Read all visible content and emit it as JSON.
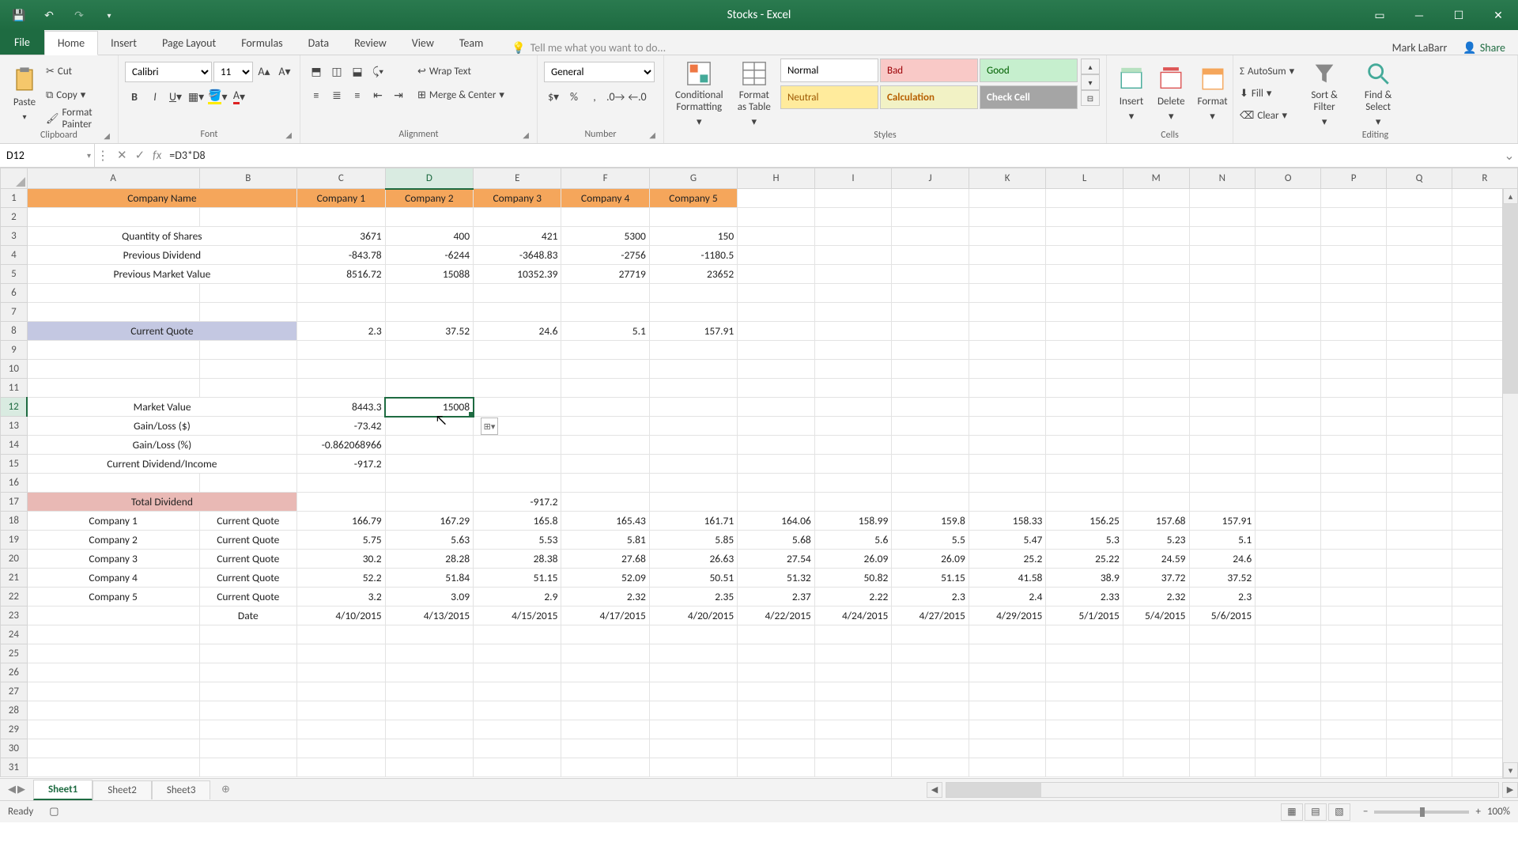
{
  "title": "Stocks - Excel",
  "account": "Mark LaBarr",
  "share": "Share",
  "tabs": {
    "file": "File",
    "home": "Home",
    "insert": "Insert",
    "pagelayout": "Page Layout",
    "formulas": "Formulas",
    "data": "Data",
    "review": "Review",
    "view": "View",
    "team": "Team"
  },
  "tellme": "Tell me what you want to do...",
  "clipboard": {
    "label": "Clipboard",
    "paste": "Paste",
    "cut": "Cut",
    "copy": "Copy",
    "painter": "Format Painter"
  },
  "font": {
    "label": "Font",
    "name": "Calibri",
    "size": "11"
  },
  "alignment": {
    "label": "Alignment",
    "wrap": "Wrap Text",
    "merge": "Merge & Center"
  },
  "number": {
    "label": "Number",
    "format": "General"
  },
  "stylesgrp": {
    "label": "Styles",
    "cond": "Conditional Formatting",
    "fmtTable": "Format as Table",
    "normal": "Normal",
    "bad": "Bad",
    "good": "Good",
    "neutral": "Neutral",
    "calc": "Calculation",
    "check": "Check Cell"
  },
  "cells": {
    "label": "Cells",
    "insert": "Insert",
    "delete": "Delete",
    "format": "Format"
  },
  "editing": {
    "label": "Editing",
    "autosum": "AutoSum",
    "fill": "Fill",
    "clear": "Clear",
    "sort": "Sort & Filter",
    "find": "Find & Select"
  },
  "namebox": "D12",
  "formula": "=D3*D8",
  "columns": [
    "A",
    "B",
    "C",
    "D",
    "E",
    "F",
    "G",
    "H",
    "I",
    "J",
    "K",
    "L",
    "M",
    "N",
    "O",
    "P",
    "Q",
    "R"
  ],
  "colpx": [
    220,
    124,
    112,
    112,
    112,
    112,
    112,
    98,
    98,
    98,
    98,
    98,
    84,
    84,
    84,
    84,
    84,
    84
  ],
  "selCol": 3,
  "selRow": 11,
  "rows": [
    [
      {
        "t": "Company Name",
        "s": "hdr-orange",
        "span": 2
      },
      null,
      {
        "t": "Company 1",
        "s": "hdr-orange"
      },
      {
        "t": "Company 2",
        "s": "hdr-orange"
      },
      {
        "t": "Company 3",
        "s": "hdr-orange"
      },
      {
        "t": "Company 4",
        "s": "hdr-orange"
      },
      {
        "t": "Company 5",
        "s": "hdr-orange"
      }
    ],
    [],
    [
      {
        "t": "Quantity of Shares",
        "s": "lbl",
        "span": 2
      },
      null,
      {
        "t": "3671"
      },
      {
        "t": "400"
      },
      {
        "t": "421"
      },
      {
        "t": "5300"
      },
      {
        "t": "150"
      }
    ],
    [
      {
        "t": "Previous Dividend",
        "s": "lbl",
        "span": 2
      },
      null,
      {
        "t": "-843.78"
      },
      {
        "t": "-6244"
      },
      {
        "t": "-3648.83"
      },
      {
        "t": "-2756"
      },
      {
        "t": "-1180.5"
      }
    ],
    [
      {
        "t": "Previous Market Value",
        "s": "lbl",
        "span": 2
      },
      null,
      {
        "t": "8516.72"
      },
      {
        "t": "15088"
      },
      {
        "t": "10352.39"
      },
      {
        "t": "27719"
      },
      {
        "t": "23652"
      }
    ],
    [],
    [],
    [
      {
        "t": "Current Quote",
        "s": "hdr-blue",
        "span": 2
      },
      null,
      {
        "t": "2.3"
      },
      {
        "t": "37.52"
      },
      {
        "t": "24.6"
      },
      {
        "t": "5.1"
      },
      {
        "t": "157.91"
      }
    ],
    [],
    [],
    [],
    [
      {
        "t": "Market Value",
        "s": "lbl",
        "span": 2
      },
      null,
      {
        "t": "8443.3"
      },
      {
        "t": "15008",
        "sel": true
      }
    ],
    [
      {
        "t": "Gain/Loss ($)",
        "s": "lbl",
        "span": 2
      },
      null,
      {
        "t": "-73.42"
      }
    ],
    [
      {
        "t": "Gain/Loss (%)",
        "s": "lbl",
        "span": 2
      },
      null,
      {
        "t": "-0.862068966"
      }
    ],
    [
      {
        "t": "Current Dividend/Income",
        "s": "lbl",
        "span": 2
      },
      null,
      {
        "t": "-917.2"
      }
    ],
    [],
    [
      {
        "t": "Total Dividend",
        "s": "hdr-pink",
        "span": 2
      },
      null,
      {
        "t": ""
      },
      {
        "t": ""
      },
      {
        "t": "-917.2"
      }
    ],
    [
      {
        "t": "Company 1",
        "s": "lbl"
      },
      {
        "t": "Current Quote",
        "s": "lbl"
      },
      {
        "t": "166.79"
      },
      {
        "t": "167.29"
      },
      {
        "t": "165.8"
      },
      {
        "t": "165.43"
      },
      {
        "t": "161.71"
      },
      {
        "t": "164.06"
      },
      {
        "t": "158.99"
      },
      {
        "t": "159.8"
      },
      {
        "t": "158.33"
      },
      {
        "t": "156.25"
      },
      {
        "t": "157.68"
      },
      {
        "t": "157.91"
      }
    ],
    [
      {
        "t": "Company 2",
        "s": "lbl"
      },
      {
        "t": "Current Quote",
        "s": "lbl"
      },
      {
        "t": "5.75"
      },
      {
        "t": "5.63"
      },
      {
        "t": "5.53"
      },
      {
        "t": "5.81"
      },
      {
        "t": "5.85"
      },
      {
        "t": "5.68"
      },
      {
        "t": "5.6"
      },
      {
        "t": "5.5"
      },
      {
        "t": "5.47"
      },
      {
        "t": "5.3"
      },
      {
        "t": "5.23"
      },
      {
        "t": "5.1"
      }
    ],
    [
      {
        "t": "Company 3",
        "s": "lbl"
      },
      {
        "t": "Current Quote",
        "s": "lbl"
      },
      {
        "t": "30.2"
      },
      {
        "t": "28.28"
      },
      {
        "t": "28.38"
      },
      {
        "t": "27.68"
      },
      {
        "t": "26.63"
      },
      {
        "t": "27.54"
      },
      {
        "t": "26.09"
      },
      {
        "t": "26.09"
      },
      {
        "t": "25.2"
      },
      {
        "t": "25.22"
      },
      {
        "t": "24.59"
      },
      {
        "t": "24.6"
      }
    ],
    [
      {
        "t": "Company 4",
        "s": "lbl"
      },
      {
        "t": "Current Quote",
        "s": "lbl"
      },
      {
        "t": "52.2"
      },
      {
        "t": "51.84"
      },
      {
        "t": "51.15"
      },
      {
        "t": "52.09"
      },
      {
        "t": "50.51"
      },
      {
        "t": "51.32"
      },
      {
        "t": "50.82"
      },
      {
        "t": "51.15"
      },
      {
        "t": "41.58"
      },
      {
        "t": "38.9"
      },
      {
        "t": "37.72"
      },
      {
        "t": "37.52"
      }
    ],
    [
      {
        "t": "Company 5",
        "s": "lbl"
      },
      {
        "t": "Current Quote",
        "s": "lbl"
      },
      {
        "t": "3.2"
      },
      {
        "t": "3.09"
      },
      {
        "t": "2.9"
      },
      {
        "t": "2.32"
      },
      {
        "t": "2.35"
      },
      {
        "t": "2.37"
      },
      {
        "t": "2.22"
      },
      {
        "t": "2.3"
      },
      {
        "t": "2.4"
      },
      {
        "t": "2.33"
      },
      {
        "t": "2.32"
      },
      {
        "t": "2.3"
      }
    ],
    [
      {
        "t": ""
      },
      {
        "t": "Date",
        "s": "lbl"
      },
      {
        "t": "4/10/2015"
      },
      {
        "t": "4/13/2015"
      },
      {
        "t": "4/15/2015"
      },
      {
        "t": "4/17/2015"
      },
      {
        "t": "4/20/2015"
      },
      {
        "t": "4/22/2015"
      },
      {
        "t": "4/24/2015"
      },
      {
        "t": "4/27/2015"
      },
      {
        "t": "4/29/2015"
      },
      {
        "t": "5/1/2015"
      },
      {
        "t": "5/4/2015"
      },
      {
        "t": "5/6/2015"
      }
    ],
    [],
    [],
    [],
    [],
    [],
    [],
    [],
    []
  ],
  "sheets": {
    "s1": "Sheet1",
    "s2": "Sheet2",
    "s3": "Sheet3"
  },
  "status": {
    "ready": "Ready",
    "zoom": "100%"
  }
}
